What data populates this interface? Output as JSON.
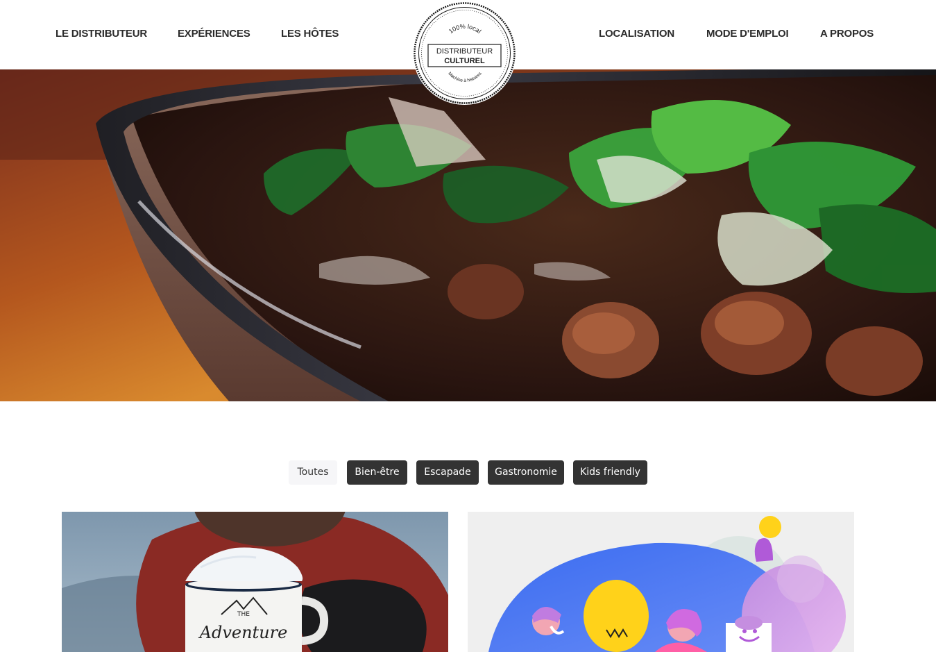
{
  "nav": {
    "left": [
      "LE DISTRIBUTEUR",
      "EXPÉRIENCES",
      "LES HÔTES"
    ],
    "right": [
      "LOCALISATION",
      "MODE D'EMPLOI",
      "A PROPOS"
    ]
  },
  "logo": {
    "top_text": "100% local",
    "line1": "DISTRIBUTEUR",
    "line2": "CULTUREL",
    "bottom_text": "Machine à histoires"
  },
  "filters": [
    "Toutes",
    "Bien-être",
    "Escapade",
    "Gastronomie",
    "Kids friendly"
  ],
  "filters_active": "Toutes",
  "cards": [
    {
      "mug_text_small": "THE",
      "mug_text": "Adventure"
    },
    {
      "illustration": "lightbulb-ideas"
    }
  ],
  "colors": {
    "text": "#2b2b2b",
    "filter_dark": "#333333",
    "filter_active_bg": "#f6f6f8",
    "illustration_blue": "#4a7ef0",
    "illustration_purple": "#c58ee0"
  }
}
